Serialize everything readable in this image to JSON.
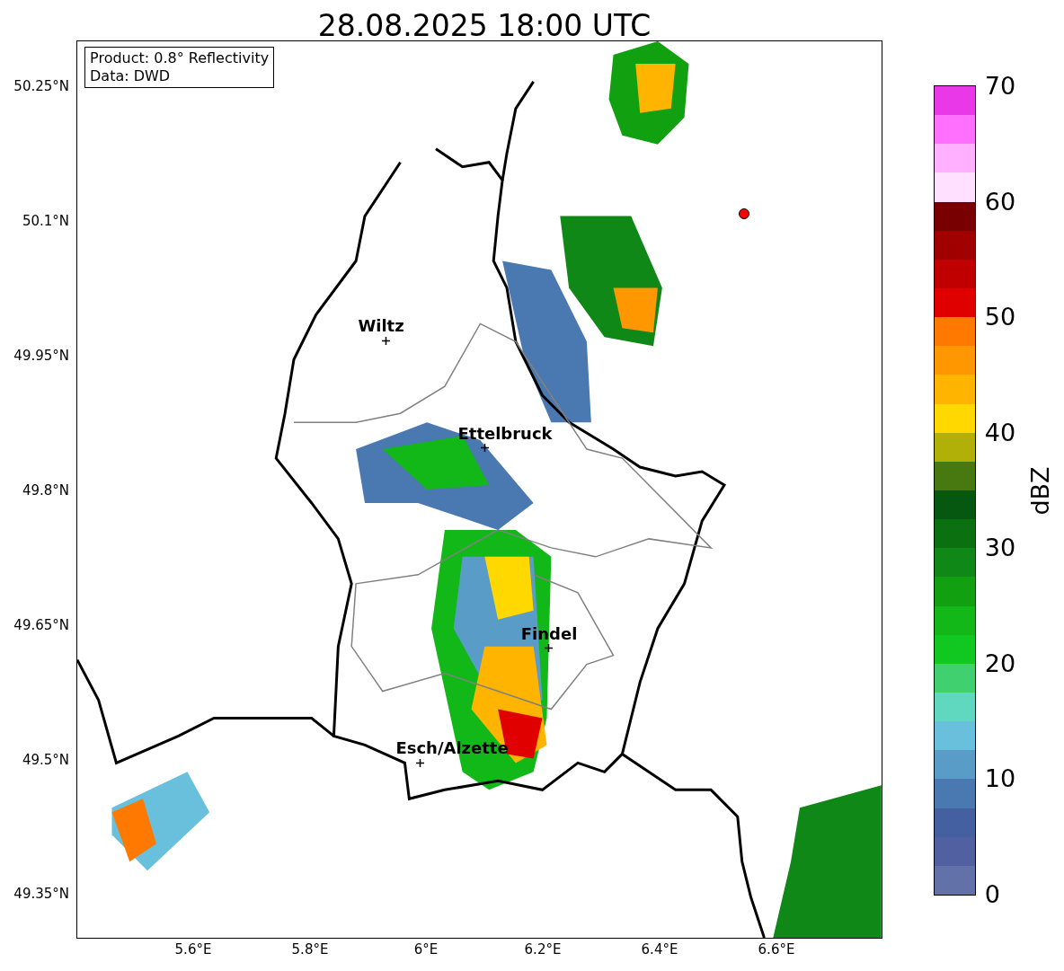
{
  "title": "28.08.2025 18:00 UTC",
  "info_box": {
    "lines": [
      "Product: 0.8° Reflectivity",
      "Data: DWD"
    ]
  },
  "y_ticks": [
    "50.25°N",
    "50.1°N",
    "49.95°N",
    "49.8°N",
    "49.65°N",
    "49.5°N",
    "49.35°N"
  ],
  "x_ticks": [
    "5.6°E",
    "5.8°E",
    "6°E",
    "6.2°E",
    "6.4°E",
    "6.6°E"
  ],
  "places": [
    {
      "name": "Wiltz"
    },
    {
      "name": "Ettelbruck"
    },
    {
      "name": "Findel"
    },
    {
      "name": "Esch/Alzette"
    }
  ],
  "colorbar": {
    "label": "dBZ",
    "ticks": [
      "70",
      "60",
      "50",
      "40",
      "30",
      "20",
      "10",
      "0"
    ],
    "bands": [
      {
        "color": "#e838e8"
      },
      {
        "color": "#ff70ff"
      },
      {
        "color": "#ffb0ff"
      },
      {
        "color": "#ffe0ff"
      },
      {
        "color": "#780000"
      },
      {
        "color": "#a00000"
      },
      {
        "color": "#c00000"
      },
      {
        "color": "#e00000"
      },
      {
        "color": "#ff7800"
      },
      {
        "color": "#ff9800"
      },
      {
        "color": "#ffb400"
      },
      {
        "color": "#ffd800"
      },
      {
        "color": "#b0b008"
      },
      {
        "color": "#487810"
      },
      {
        "color": "#065810"
      },
      {
        "color": "#0a7010"
      },
      {
        "color": "#108818"
      },
      {
        "color": "#10a010"
      },
      {
        "color": "#12b818"
      },
      {
        "color": "#10c820"
      },
      {
        "color": "#40d070"
      },
      {
        "color": "#60d8c0"
      },
      {
        "color": "#68c0dc"
      },
      {
        "color": "#5a9cc8"
      },
      {
        "color": "#4a78b0"
      },
      {
        "color": "#4460a0"
      },
      {
        "color": "#5060a0"
      },
      {
        "color": "#6272a8"
      }
    ]
  }
}
